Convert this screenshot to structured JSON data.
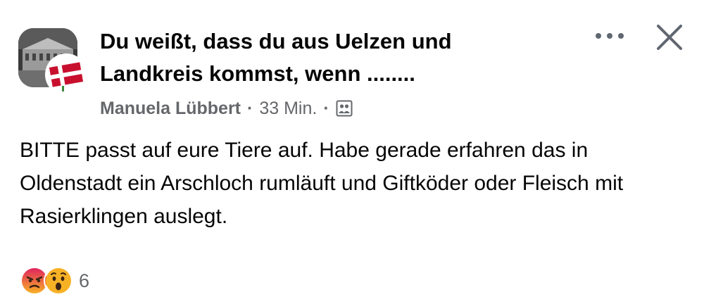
{
  "post": {
    "group_title": "Du weißt, dass du aus  Uelzen und Landkreis kommst, wenn ........",
    "author": "Manuela Lübbert",
    "separator": "·",
    "time": "33 Min.",
    "audience_icon": "group-audience-icon",
    "body": "BITTE passt auf eure Tiere auf. Habe gerade erfahren das in Oldenstadt ein Arschloch rumläuft und Giftköder oder Fleisch mit Rasierklingen auslegt.",
    "reactions": {
      "icons": [
        "angry-reaction-icon",
        "wow-reaction-icon"
      ],
      "count": "6"
    }
  },
  "colors": {
    "text_primary": "#050505",
    "text_secondary": "#65676b",
    "angry": "#e9710f",
    "wow": "#f7b125",
    "flag_red": "#c8102e"
  }
}
